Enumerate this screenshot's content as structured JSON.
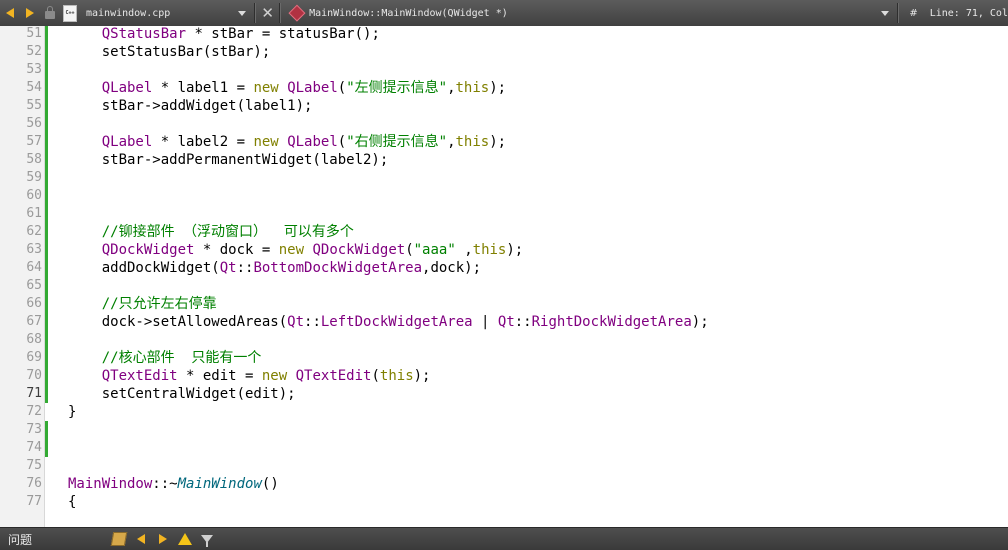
{
  "toolbar": {
    "file_icon_text": "C++",
    "file_name": "mainwindow.cpp",
    "method_name": "MainWindow::MainWindow(QWidget *)",
    "hash": "#",
    "line_info": "Line: 71, Col"
  },
  "colors": {
    "keyword": "#808000",
    "type": "#800080",
    "string": "#008000",
    "comment": "#008000",
    "modified_marker": "#33aa33"
  },
  "editor": {
    "current_line": "71",
    "lines": [
      {
        "n": "51",
        "modified": true,
        "tokens": [
          {
            "t": "    "
          },
          {
            "t": "QStatusBar",
            "c": "ty"
          },
          {
            "t": " * stBar = statusBar();"
          }
        ]
      },
      {
        "n": "52",
        "modified": true,
        "tokens": [
          {
            "t": "    setStatusBar(stBar);"
          }
        ]
      },
      {
        "n": "53",
        "modified": true,
        "tokens": []
      },
      {
        "n": "54",
        "modified": true,
        "tokens": [
          {
            "t": "    "
          },
          {
            "t": "QLabel",
            "c": "ty"
          },
          {
            "t": " * label1 = "
          },
          {
            "t": "new",
            "c": "kw"
          },
          {
            "t": " "
          },
          {
            "t": "QLabel",
            "c": "ty"
          },
          {
            "t": "("
          },
          {
            "t": "\"左侧提示信息\"",
            "c": "str"
          },
          {
            "t": ","
          },
          {
            "t": "this",
            "c": "kw"
          },
          {
            "t": ");"
          }
        ]
      },
      {
        "n": "55",
        "modified": true,
        "tokens": [
          {
            "t": "    stBar->addWidget(label1);"
          }
        ]
      },
      {
        "n": "56",
        "modified": true,
        "tokens": []
      },
      {
        "n": "57",
        "modified": true,
        "tokens": [
          {
            "t": "    "
          },
          {
            "t": "QLabel",
            "c": "ty"
          },
          {
            "t": " * label2 = "
          },
          {
            "t": "new",
            "c": "kw"
          },
          {
            "t": " "
          },
          {
            "t": "QLabel",
            "c": "ty"
          },
          {
            "t": "("
          },
          {
            "t": "\"右侧提示信息\"",
            "c": "str"
          },
          {
            "t": ","
          },
          {
            "t": "this",
            "c": "kw"
          },
          {
            "t": ");"
          }
        ]
      },
      {
        "n": "58",
        "modified": true,
        "tokens": [
          {
            "t": "    stBar->addPermanentWidget(label2);"
          }
        ]
      },
      {
        "n": "59",
        "modified": true,
        "tokens": []
      },
      {
        "n": "60",
        "modified": true,
        "tokens": []
      },
      {
        "n": "61",
        "modified": true,
        "tokens": []
      },
      {
        "n": "62",
        "modified": true,
        "tokens": [
          {
            "t": "    "
          },
          {
            "t": "//铆接部件 （浮动窗口）  可以有多个",
            "c": "cm"
          }
        ]
      },
      {
        "n": "63",
        "modified": true,
        "tokens": [
          {
            "t": "    "
          },
          {
            "t": "QDockWidget",
            "c": "ty"
          },
          {
            "t": " * dock = "
          },
          {
            "t": "new",
            "c": "kw"
          },
          {
            "t": " "
          },
          {
            "t": "QDockWidget",
            "c": "ty"
          },
          {
            "t": "("
          },
          {
            "t": "\"aaa\"",
            "c": "str"
          },
          {
            "t": " ,"
          },
          {
            "t": "this",
            "c": "kw"
          },
          {
            "t": ");"
          }
        ]
      },
      {
        "n": "64",
        "modified": true,
        "tokens": [
          {
            "t": "    addDockWidget("
          },
          {
            "t": "Qt",
            "c": "ty"
          },
          {
            "t": "::"
          },
          {
            "t": "BottomDockWidgetArea",
            "c": "ty"
          },
          {
            "t": ",dock);"
          }
        ]
      },
      {
        "n": "65",
        "modified": true,
        "tokens": []
      },
      {
        "n": "66",
        "modified": true,
        "tokens": [
          {
            "t": "    "
          },
          {
            "t": "//只允许左右停靠",
            "c": "cm"
          }
        ]
      },
      {
        "n": "67",
        "modified": true,
        "tokens": [
          {
            "t": "    dock->setAllowedAreas("
          },
          {
            "t": "Qt",
            "c": "ty"
          },
          {
            "t": "::"
          },
          {
            "t": "LeftDockWidgetArea",
            "c": "ty"
          },
          {
            "t": " | "
          },
          {
            "t": "Qt",
            "c": "ty"
          },
          {
            "t": "::"
          },
          {
            "t": "RightDockWidgetArea",
            "c": "ty"
          },
          {
            "t": ");"
          }
        ]
      },
      {
        "n": "68",
        "modified": true,
        "tokens": []
      },
      {
        "n": "69",
        "modified": true,
        "tokens": [
          {
            "t": "    "
          },
          {
            "t": "//核心部件  只能有一个",
            "c": "cm"
          }
        ]
      },
      {
        "n": "70",
        "modified": true,
        "tokens": [
          {
            "t": "    "
          },
          {
            "t": "QTextEdit",
            "c": "ty"
          },
          {
            "t": " * edit = "
          },
          {
            "t": "new",
            "c": "kw"
          },
          {
            "t": " "
          },
          {
            "t": "QTextEdit",
            "c": "ty"
          },
          {
            "t": "("
          },
          {
            "t": "this",
            "c": "kw"
          },
          {
            "t": ");"
          }
        ]
      },
      {
        "n": "71",
        "modified": true,
        "tokens": [
          {
            "t": "    setCentralWidget(edit);"
          }
        ]
      },
      {
        "n": "72",
        "modified": false,
        "tokens": [
          {
            "t": "}"
          }
        ]
      },
      {
        "n": "73",
        "modified": true,
        "tokens": []
      },
      {
        "n": "74",
        "modified": true,
        "tokens": []
      },
      {
        "n": "75",
        "modified": false,
        "tokens": []
      },
      {
        "n": "76",
        "modified": false,
        "tokens": [
          {
            "t": "MainWindow",
            "c": "cls"
          },
          {
            "t": "::~"
          },
          {
            "t": "MainWindow",
            "c": "fn-it"
          },
          {
            "t": "()"
          }
        ]
      },
      {
        "n": "77",
        "modified": false,
        "tokens": [
          {
            "t": "{"
          }
        ]
      }
    ]
  },
  "statusbar": {
    "issues_label": "问题"
  }
}
